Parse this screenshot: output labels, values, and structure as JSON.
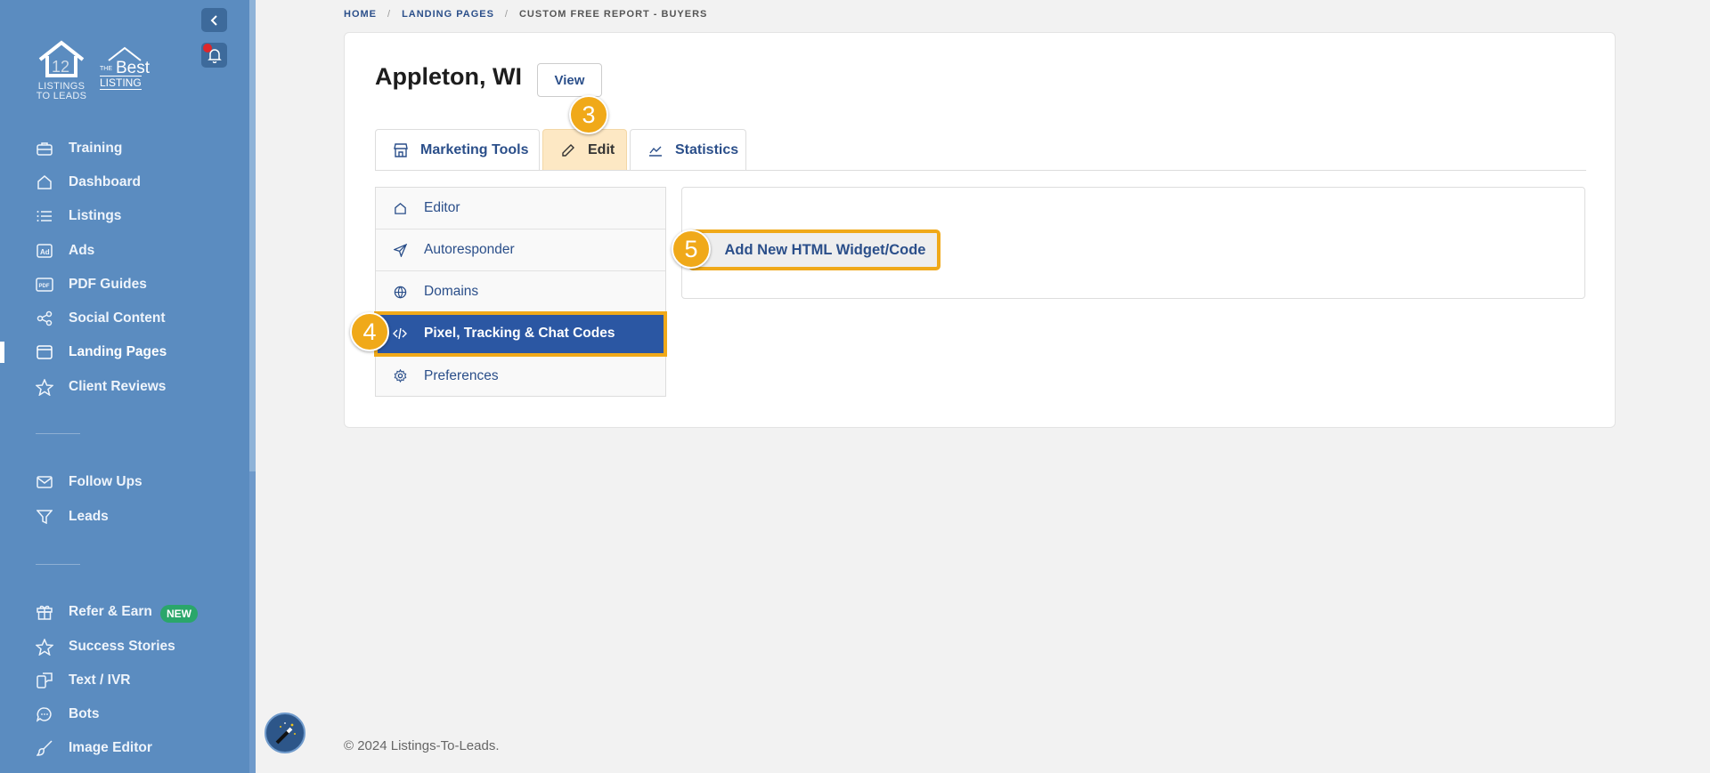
{
  "sidebar": {
    "logo_primary_text": "LISTINGS\nTO LEADS",
    "logo_primary_line1": "LISTINGS",
    "logo_primary_line2": "TO LEADS",
    "logo_secondary_small": "THE",
    "logo_secondary_big": "Best",
    "logo_secondary_listing": "LISTING",
    "items": [
      {
        "label": "Training",
        "icon": "briefcase-icon"
      },
      {
        "label": "Dashboard",
        "icon": "home-icon"
      },
      {
        "label": "Listings",
        "icon": "list-icon"
      },
      {
        "label": "Ads",
        "icon": "ad-icon"
      },
      {
        "label": "PDF Guides",
        "icon": "pdf-icon"
      },
      {
        "label": "Social Content",
        "icon": "share-icon"
      },
      {
        "label": "Landing Pages",
        "icon": "browser-icon",
        "active": true
      },
      {
        "label": "Client Reviews",
        "icon": "star-icon"
      },
      {
        "label": "Follow Ups",
        "icon": "mail-icon"
      },
      {
        "label": "Leads",
        "icon": "filter-icon"
      },
      {
        "label": "Refer & Earn",
        "icon": "gift-icon",
        "badge": "NEW"
      },
      {
        "label": "Success Stories",
        "icon": "star-icon"
      },
      {
        "label": "Text / IVR",
        "icon": "phone-message-icon"
      },
      {
        "label": "Bots",
        "icon": "chat-icon"
      },
      {
        "label": "Image Editor",
        "icon": "brush-icon"
      }
    ]
  },
  "breadcrumb": {
    "home": "HOME",
    "landing_pages": "LANDING PAGES",
    "current": "CUSTOM FREE REPORT - BUYERS",
    "separator": "/"
  },
  "page": {
    "title": "Appleton, WI",
    "view_label": "View"
  },
  "tabs": [
    {
      "label": "Marketing Tools",
      "icon": "store-icon"
    },
    {
      "label": "Edit",
      "icon": "pencil-icon",
      "active": true
    },
    {
      "label": "Statistics",
      "icon": "chart-line-icon"
    }
  ],
  "submenu": [
    {
      "label": "Editor",
      "icon": "home-icon"
    },
    {
      "label": "Autoresponder",
      "icon": "send-icon"
    },
    {
      "label": "Domains",
      "icon": "globe-icon"
    },
    {
      "label": "Pixel, Tracking & Chat Codes",
      "icon": "code-icon",
      "active": true
    },
    {
      "label": "Preferences",
      "icon": "gear-icon"
    }
  ],
  "panel": {
    "add_widget_label": "Add New HTML Widget/Code"
  },
  "steps": {
    "step3": "3",
    "step4": "4",
    "step5": "5"
  },
  "footer": {
    "copyright": "© 2024 Listings-To-Leads."
  },
  "colors": {
    "sidebar_bg": "#5b8cc0",
    "accent_blue": "#2b57a3",
    "highlight_orange": "#f0a919",
    "edit_tab_bg": "#fde8c4"
  }
}
